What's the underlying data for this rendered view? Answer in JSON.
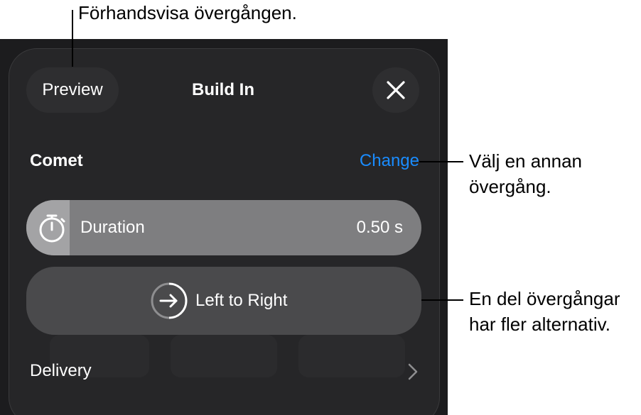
{
  "header": {
    "preview_label": "Preview",
    "title": "Build In",
    "close_icon": "close-icon"
  },
  "effect": {
    "name": "Comet",
    "change_label": "Change",
    "change_color": "#1a8cff"
  },
  "duration": {
    "label": "Duration",
    "value": "0.50 s",
    "icon": "stopwatch-icon",
    "fill_fraction": 0.11
  },
  "direction": {
    "label": "Left to Right",
    "icon": "arrow-right-circle-icon"
  },
  "delivery": {
    "label": "Delivery",
    "icon": "chevron-right-icon"
  },
  "annotations": {
    "preview_callout": "Förhandsvisa övergången.",
    "change_callout_line1": "Välj en annan",
    "change_callout_line2": "övergång.",
    "direction_callout_line1": "En del övergångar",
    "direction_callout_line2": "har fler alternativ."
  }
}
